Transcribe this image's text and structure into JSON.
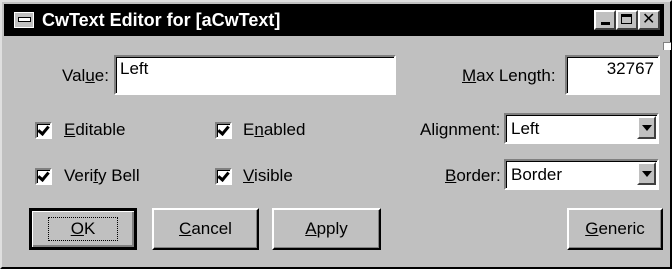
{
  "window": {
    "title": "CwText Editor for [aCwText]"
  },
  "fields": {
    "value_label_pre": "Val",
    "value_label_mn": "u",
    "value_label_post": "e:",
    "value": "Left",
    "maxlen_label_mn": "M",
    "maxlen_label_post": "ax Length:",
    "maxlen": "32767"
  },
  "checkboxes": {
    "editable": {
      "mn": "E",
      "rest": "ditable",
      "checked": true
    },
    "enabled": {
      "pre": "E",
      "mn": "n",
      "rest": "abled",
      "checked": true
    },
    "verify_bell": {
      "pre": "Veri",
      "mn": "f",
      "rest": "y Bell",
      "checked": true
    },
    "visible": {
      "mn": "V",
      "rest": "isible",
      "checked": true
    }
  },
  "combos": {
    "alignment_label_pre": "Alignment:",
    "alignment": "Left",
    "border_label_mn": "B",
    "border_label_post": "order:",
    "border": "Border"
  },
  "buttons": {
    "ok_mn": "O",
    "ok_rest": "K",
    "cancel_mn": "C",
    "cancel_rest": "ancel",
    "apply_mn": "A",
    "apply_rest": "pply",
    "generic_mn": "G",
    "generic_rest": "eneric"
  }
}
